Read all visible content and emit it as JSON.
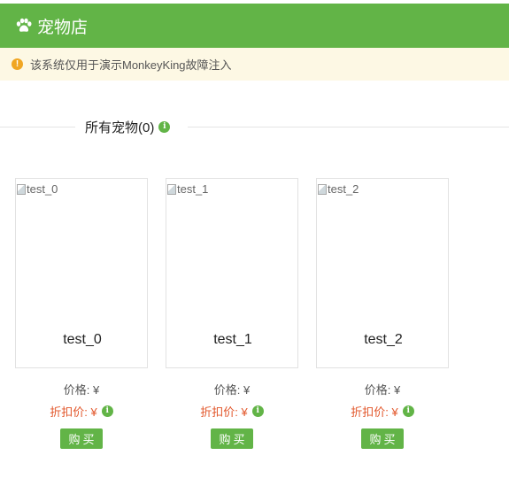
{
  "header": {
    "title": "宠物店",
    "icon": "paw-icon"
  },
  "notice": {
    "text": "该系统仅用于演示MonkeyKing故障注入",
    "icon": "warning-icon"
  },
  "section": {
    "title": "所有宠物(0)",
    "info_icon": "i"
  },
  "pets": [
    {
      "alt": "test_0",
      "name": "test_0",
      "price_label": "价格: ¥",
      "discount_label": "折扣价: ¥",
      "info": "i",
      "buy_label": "购买"
    },
    {
      "alt": "test_1",
      "name": "test_1",
      "price_label": "价格: ¥",
      "discount_label": "折扣价: ¥",
      "info": "i",
      "buy_label": "购买"
    },
    {
      "alt": "test_2",
      "name": "test_2",
      "price_label": "价格: ¥",
      "discount_label": "折扣价: ¥",
      "info": "i",
      "buy_label": "购买"
    }
  ],
  "colors": {
    "primary": "#62b447",
    "notice_bg": "#fdf8e4",
    "warning": "#f0a623",
    "discount": "#e2572b"
  }
}
